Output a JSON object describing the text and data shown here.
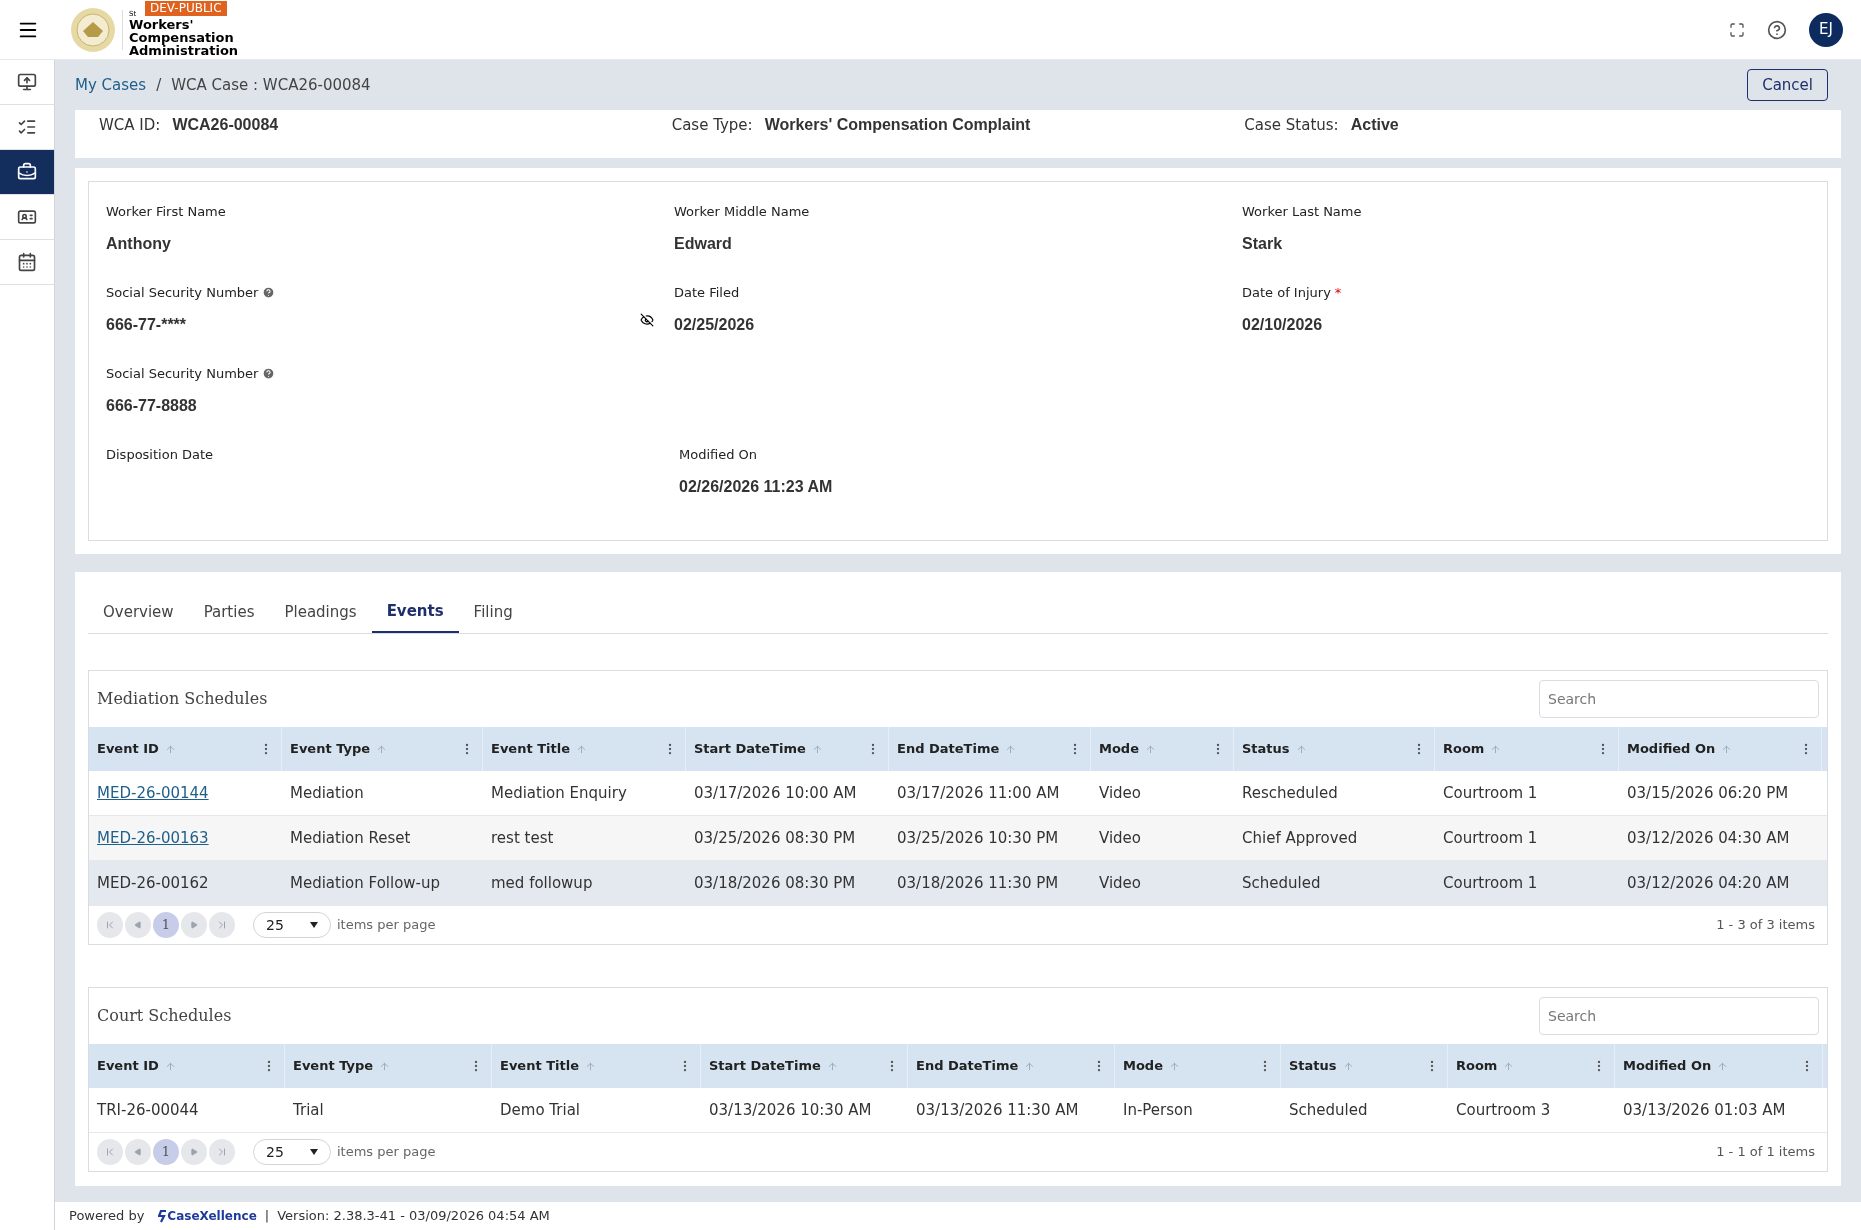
{
  "header": {
    "badge": "DEV-PUBLIC",
    "logo_small": "St",
    "logo_lines": [
      "Workers'",
      "Compensation",
      "Administration"
    ],
    "avatar": "EJ"
  },
  "sidebar": {
    "items": [
      {
        "selected": false
      },
      {
        "selected": false
      },
      {
        "selected": true
      },
      {
        "selected": false
      },
      {
        "selected": false
      }
    ]
  },
  "breadcrumb": {
    "link": "My Cases",
    "separator": "/",
    "current": "WCA Case : WCA26-00084"
  },
  "cancel_button": "Cancel",
  "summary": [
    {
      "label": "WCA ID:",
      "value": "WCA26-00084"
    },
    {
      "label": "Case Type:",
      "value": "Workers' Compensation Complaint"
    },
    {
      "label": "Case Status:",
      "value": "Active"
    }
  ],
  "details": [
    [
      {
        "label": "Worker First Name",
        "value": "Anthony"
      },
      {
        "label": "Worker Middle Name",
        "value": "Edward"
      },
      {
        "label": "Worker Last Name",
        "value": "Stark"
      }
    ],
    [
      {
        "label": "Social Security Number",
        "value": "666-77-****",
        "help": true,
        "toggle": true
      },
      {
        "label": "Date Filed",
        "value": "02/25/2026"
      },
      {
        "label": "Date of Injury",
        "value": "02/10/2026",
        "required_mark": "*"
      }
    ],
    [
      {
        "label": "Social Security Number",
        "value": "666-77-8888",
        "help": true
      }
    ],
    [
      {
        "label": "Disposition Date"
      },
      {
        "label": "Modified On",
        "value": "02/26/2026 11:23 AM"
      }
    ]
  ],
  "tabs": [
    {
      "label": "Overview",
      "selected": false
    },
    {
      "label": "Parties",
      "selected": false
    },
    {
      "label": "Pleadings",
      "selected": false
    },
    {
      "label": "Events",
      "selected": true
    },
    {
      "label": "Filing",
      "selected": false
    }
  ],
  "tables": [
    {
      "title": "Mediation Schedules",
      "search": {
        "placeholder": "Search"
      },
      "columns": [
        "Event ID",
        "Event Type",
        "Event Title",
        "Start DateTime",
        "End DateTime",
        "Mode",
        "Status",
        "Room",
        "Modified On"
      ],
      "rows": [
        {
          "link": true,
          "selected": false,
          "cells": [
            "MED-26-00144",
            "Mediation",
            "Mediation Enquiry",
            "03/17/2026 10:00 AM",
            "03/17/2026 11:00 AM",
            "Video",
            "Rescheduled",
            "Courtroom 1",
            "03/15/2026 06:20 PM"
          ]
        },
        {
          "link": true,
          "selected": false,
          "cells": [
            "MED-26-00163",
            "Mediation Reset",
            "rest test",
            "03/25/2026 08:30 PM",
            "03/25/2026 10:30 PM",
            "Video",
            "Chief Approved",
            "Courtroom 1",
            "03/12/2026 04:30 AM"
          ]
        },
        {
          "link": false,
          "selected": true,
          "cells": [
            "MED-26-00162",
            "Mediation Follow-up",
            "med followup",
            "03/18/2026 08:30 PM",
            "03/18/2026 11:30 PM",
            "Video",
            "Scheduled",
            "Courtroom 1",
            "03/12/2026 04:20 AM"
          ]
        }
      ],
      "pager": {
        "page": "1",
        "page_size": "25",
        "per_page_label": "items per page",
        "summary": "1 - 3 of 3 items"
      }
    },
    {
      "title": "Court Schedules",
      "search": {
        "placeholder": "Search"
      },
      "columns": [
        "Event ID",
        "Event Type",
        "Event Title",
        "Start DateTime",
        "End DateTime",
        "Mode",
        "Status",
        "Room",
        "Modified On"
      ],
      "rows": [
        {
          "link": false,
          "selected": false,
          "cells": [
            "TRI-26-00044",
            "Trial",
            "Demo Trial",
            "03/13/2026 10:30 AM",
            "03/13/2026 11:30 AM",
            "In-Person",
            "Scheduled",
            "Courtroom 3",
            "03/13/2026 01:03 AM"
          ]
        }
      ],
      "pager": {
        "page": "1",
        "page_size": "25",
        "per_page_label": "items per page",
        "summary": "1 - 1 of 1 items"
      }
    }
  ],
  "footer": {
    "powered_by": "Powered by",
    "brand": "CaseXellence",
    "separator": "|",
    "version": "Version: 2.38.3-41 - 03/09/2026 04:54 AM"
  }
}
